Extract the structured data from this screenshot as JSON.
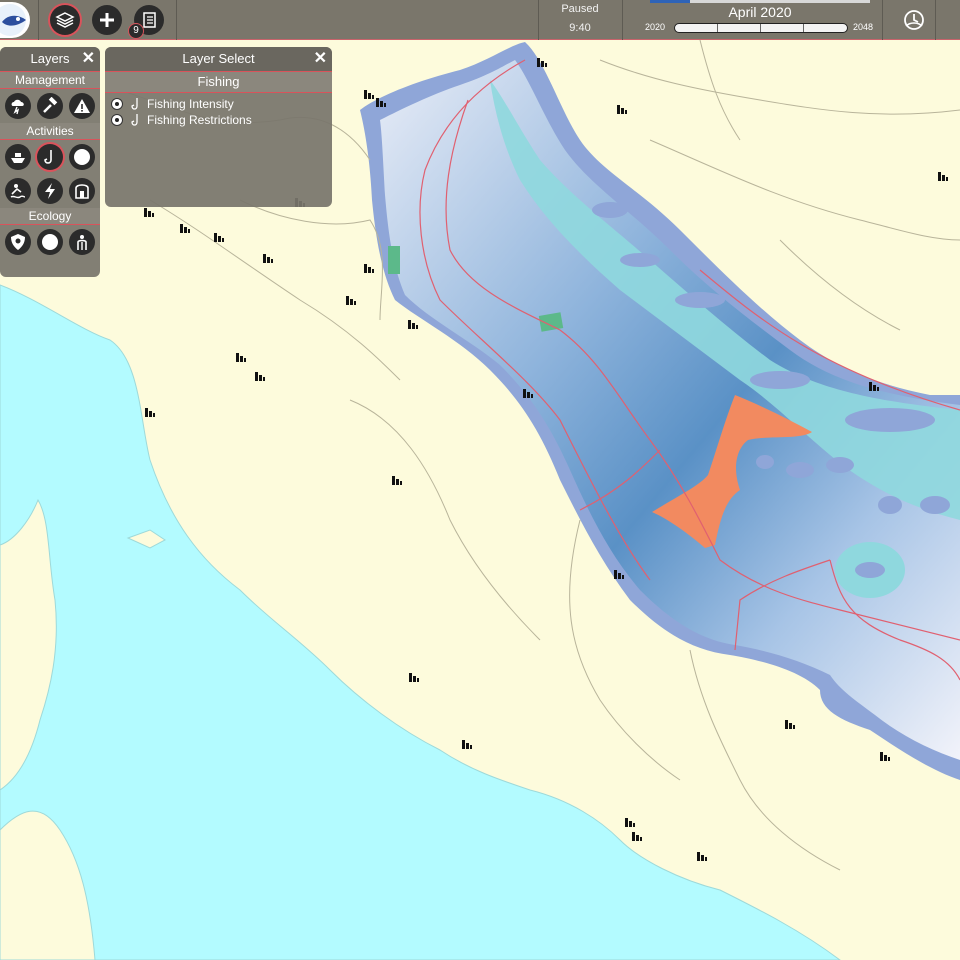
{
  "topbar": {
    "timeline_start": "2020",
    "timeline_end": "2048",
    "current_date": "April 2020",
    "status": "Paused",
    "clock": "9:40",
    "notification_count": "9"
  },
  "layers_panel": {
    "title": "Layers",
    "sections": [
      {
        "label": "Management",
        "icons": [
          "storm-cloud-icon",
          "hammer-icon",
          "warning-icon"
        ]
      },
      {
        "label": "Activities",
        "icons": [
          "ship-icon",
          "fishing-hook-icon",
          "circle-icon",
          "swimmer-icon",
          "lightning-icon",
          "building-icon"
        ]
      },
      {
        "label": "Ecology",
        "icons": [
          "shield-icon",
          "circle-icon",
          "people-icon"
        ]
      }
    ]
  },
  "layer_select_panel": {
    "title": "Layer Select",
    "category": "Fishing",
    "layers": [
      {
        "label": "Fishing Intensity",
        "checked": false
      },
      {
        "label": "Fishing Restrictions",
        "checked": false
      }
    ]
  },
  "colors": {
    "land": "#fdfbdc",
    "tyrrhenian_sea": "#b3fbff",
    "adriatic_sea": "#8fa6d8",
    "shallow_band": "#8fd8de",
    "restriction_area": "#f28a60",
    "borders": "#e06070",
    "accent": "#d9535b",
    "ui_panel": "#78756c"
  }
}
